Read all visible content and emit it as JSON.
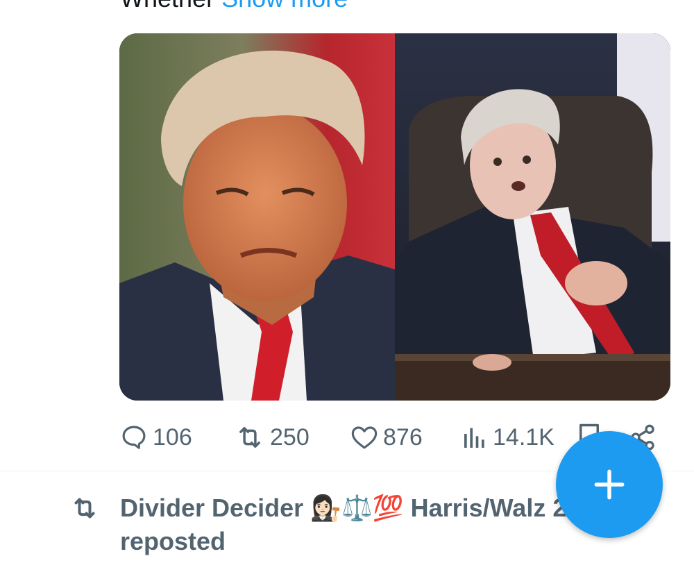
{
  "tweet": {
    "text_fragment": "Whether ",
    "show_more_label": "Show more"
  },
  "media": {
    "photos": [
      {
        "alt_icon": "photo-portrait-icon"
      },
      {
        "alt_icon": "photo-seated-icon"
      }
    ]
  },
  "actions": {
    "reply_count": "106",
    "repost_count": "250",
    "like_count": "876",
    "views_count": "14.1K"
  },
  "repost_notice": {
    "name": "Divider Decider 👩🏻‍⚖️⚖️💯 Harris/Walz 2",
    "label": "reposted"
  },
  "colors": {
    "accent": "#1d9bf0",
    "secondary_text": "#536471"
  },
  "fab": {
    "icon": "plus-icon"
  }
}
